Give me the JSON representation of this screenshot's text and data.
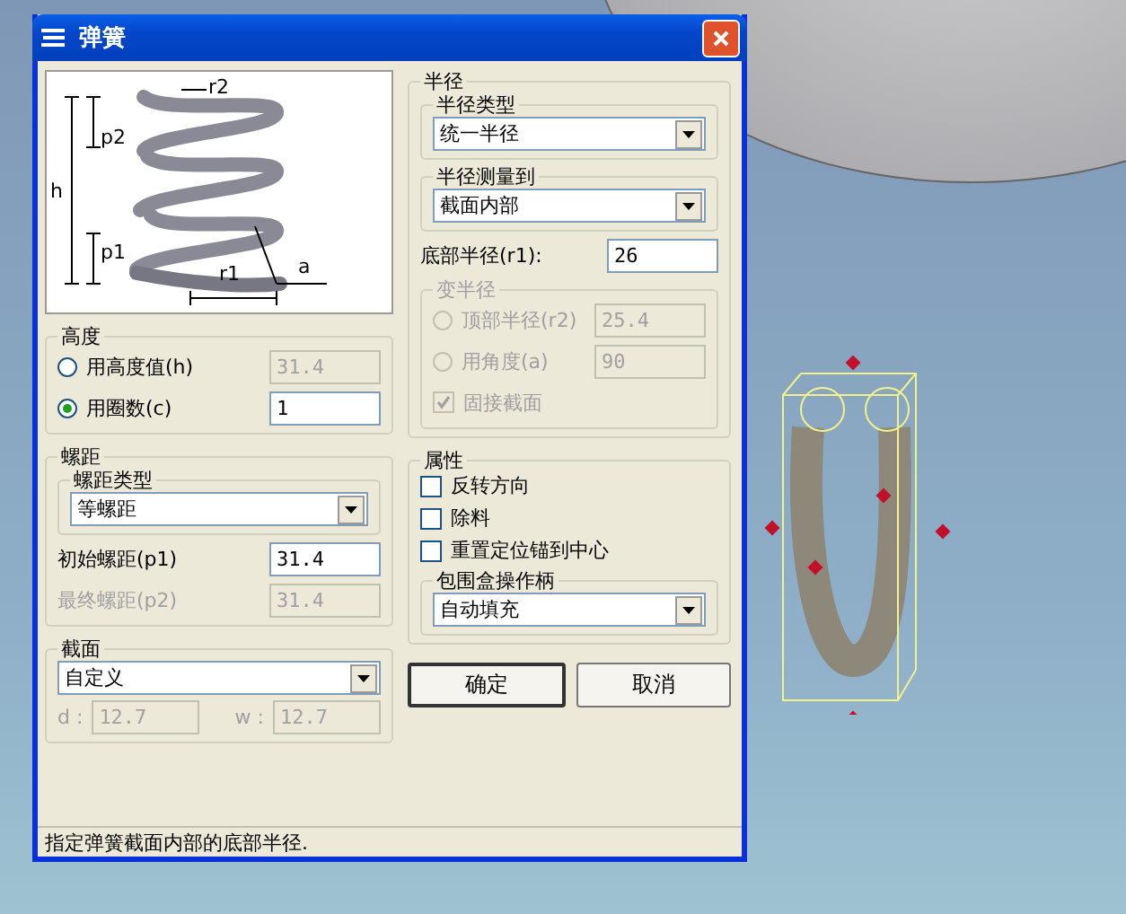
{
  "window": {
    "title": "弹簧"
  },
  "diagram_labels": [
    "r2",
    "p2",
    "h",
    "p1",
    "a",
    "r1"
  ],
  "height_group": {
    "title": "高度",
    "options": [
      {
        "label": "用高度值(h)",
        "selected": false,
        "value": "31.4",
        "disabled": true
      },
      {
        "label": "用圈数(c)",
        "selected": true,
        "value": "1",
        "disabled": false
      }
    ]
  },
  "pitch_group": {
    "title": "螺距",
    "pitch_type": {
      "title": "螺距类型",
      "value": "等螺距"
    },
    "fields": [
      {
        "label": "初始螺距(p1)",
        "value": "31.4",
        "disabled": false
      },
      {
        "label": "最终螺距(p2)",
        "value": "31.4",
        "disabled": true
      }
    ]
  },
  "section_group": {
    "title": "截面",
    "value": "自定义",
    "fields": [
      {
        "label": "d :",
        "value": "12.7",
        "disabled": true
      },
      {
        "label": "w :",
        "value": "12.7",
        "disabled": true
      }
    ]
  },
  "radius_group": {
    "title": "半径",
    "radius_type": {
      "title": "半径类型",
      "value": "统一半径"
    },
    "measure_to": {
      "title": "半径测量到",
      "value": "截面内部"
    },
    "bottom_radius": {
      "label": "底部半径(r1):",
      "value": "26",
      "disabled": false
    },
    "variable_radius": {
      "title": "变半径",
      "disabled": true,
      "options": [
        {
          "label": "顶部半径(r2)",
          "value": "25.4",
          "selected": false
        },
        {
          "label": "用角度(a)",
          "value": "90",
          "selected": false
        }
      ],
      "checkbox": {
        "label": "固接截面",
        "checked": true
      }
    }
  },
  "properties": {
    "title": "属性",
    "checkboxes": [
      {
        "label": "反转方向",
        "checked": false
      },
      {
        "label": "除料",
        "checked": false
      },
      {
        "label": "重置定位锚到中心",
        "checked": false
      }
    ],
    "handle": {
      "title": "包围盒操作柄",
      "value": "自动填充"
    }
  },
  "buttons": [
    {
      "label": "确定",
      "default": true
    },
    {
      "label": "取消",
      "default": false
    }
  ],
  "status_bar": "指定弹簧截面内部的底部半径."
}
